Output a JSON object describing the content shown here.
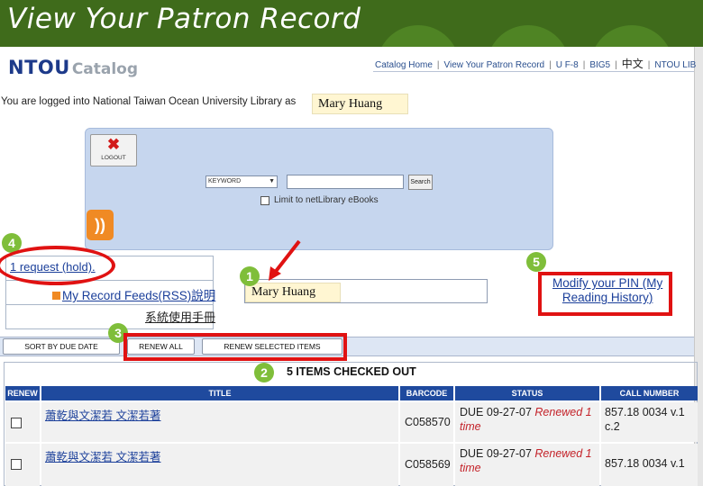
{
  "slide": {
    "title": "View Your Patron Record"
  },
  "catalog": {
    "logo_main": "NTOU",
    "logo_sub": "Catalog",
    "nav": {
      "home": "Catalog Home",
      "patron_record": "View Your Patron Record",
      "utf8": "U F-8",
      "big5": "BIG5",
      "chinese": "中文",
      "ntou_lib": "NTOU LIB"
    },
    "logged_in_text": "You are logged into National Taiwan Ocean University Library as",
    "patron_name": "Mary Huang",
    "logout_label": "LOGOUT",
    "search": {
      "select_value": "KEYWORD",
      "button_label": "Search",
      "limit_label": "Limit to netLibrary eBooks"
    },
    "left_panel": {
      "request_link": "1 request (hold).",
      "feeds_link": "My Record Feeds(RSS)說明",
      "manual_link": "系統使用手冊"
    },
    "modify_pin_line1": "Modify your PIN (My",
    "modify_pin_line2": "Reading History)",
    "tabs": {
      "sort": "SORT BY DUE DATE",
      "renew_all": "RENEW ALL",
      "renew_selected": "RENEW SELECTED ITEMS"
    },
    "items_heading": "5 ITEMS CHECKED OUT",
    "table": {
      "headers": [
        "RENEW",
        "TITLE",
        "BARCODE",
        "STATUS",
        "CALL NUMBER"
      ],
      "rows": [
        {
          "title": "蕭乾與文潔若 文潔若著",
          "barcode": "C058570",
          "due": "DUE 09-27-07",
          "renewed": "Renewed 1",
          "times": "time",
          "call1": "857.18 0034 v.1",
          "call2": "c.2"
        },
        {
          "title": "蕭乾與文潔若 文潔若著",
          "barcode": "C058569",
          "due": "DUE 09-27-07",
          "renewed": "Renewed 1",
          "times": "time",
          "call1": "857.18 0034 v.1",
          "call2": ""
        }
      ]
    }
  },
  "annotations": {
    "badges": [
      "1",
      "2",
      "3",
      "4",
      "5"
    ],
    "highlight_color": "#e01212",
    "badge_color": "#7fbe3a"
  }
}
